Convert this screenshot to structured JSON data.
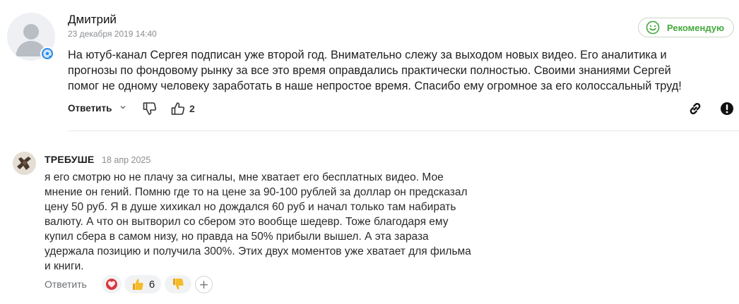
{
  "review1": {
    "author": "Дмитрий",
    "date": "23 декабря 2019 14:40",
    "recommend_label": "Рекомендую",
    "text_lines": [
      "На ютуб-канал Сергея подписан уже второй год. Внимательно слежу за выходом новых видео. Его аналитика и",
      "прогнозы по фондовому рынку за все это время оправдались практически полностью. Своими знаниями Сергей",
      "помог не одному человеку заработать в наше непростое время. Спасибо ему огромное за его колоссальный труд!"
    ],
    "reply_label": "Ответить",
    "like_count": "2",
    "icons": [
      "avatar-placeholder-icon",
      "mail-badge-icon",
      "smile-icon",
      "chevron-down-icon",
      "thumbs-down-icon",
      "thumbs-up-icon",
      "link-icon",
      "warning-icon"
    ]
  },
  "review2": {
    "author": "ТРЕБУШЕ",
    "date": "18 апр 2025",
    "text_lines": [
      "я его смотрю но не плачу за сигналы, мне хватает его бесплатных видео. Мое",
      "мнение он гений. Помню где то на цене за 90-100 рублей за доллар он предсказал",
      "цену 50 руб. Я в душе хихикал но дождался 60 руб и начал только там набирать",
      "валюту. А что он вытворил со сбером это вообще шедевр. Тоже благодаря ему",
      "купил сбера в самом низу, но правда на 50% прибыли вышел. А эта зараза",
      "удержала позицию и получила 300%. Этих двух моментов уже хватает для фильма",
      "и книги."
    ],
    "reply_label": "Ответить",
    "reactions": [
      {
        "icon": "heart-reaction-icon",
        "count": ""
      },
      {
        "icon": "thumbs-up-emoji-icon",
        "count": "6"
      },
      {
        "icon": "thumbs-down-emoji-icon",
        "count": ""
      }
    ],
    "add_reaction_label": "+"
  },
  "colors": {
    "accent_green": "#42a93b",
    "badge_blue": "#2f8ee8",
    "muted_text": "#8a8d91"
  }
}
